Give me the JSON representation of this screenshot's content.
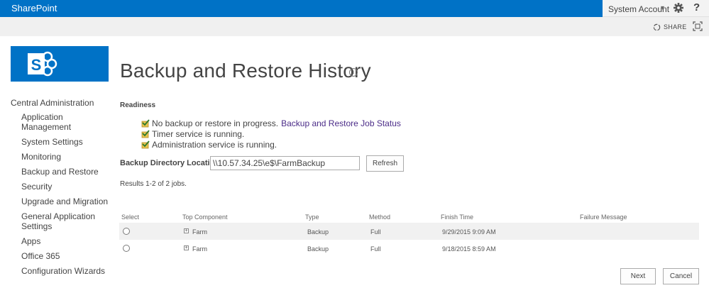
{
  "suitebar": {
    "brand": "SharePoint",
    "user_name": "System Account",
    "user_caret": "▾",
    "help_label": "?",
    "color": "#0072c6"
  },
  "ribbon": {
    "share_label": "SHARE"
  },
  "page": {
    "title": "Backup and Restore History",
    "info_glyph": "i"
  },
  "leftnav": {
    "root": "Central Administration",
    "items": [
      "Application Management",
      "System Settings",
      "Monitoring",
      "Backup and Restore",
      "Security",
      "Upgrade and Migration",
      "General Application Settings",
      "Apps",
      "Office 365",
      "Configuration Wizards"
    ]
  },
  "readiness": {
    "heading": "Readiness",
    "lines": [
      {
        "text": "No backup or restore in progress.",
        "link": "Backup and Restore Job Status"
      },
      {
        "text": "Timer service is running."
      },
      {
        "text": "Administration service is running."
      }
    ]
  },
  "backup_dir": {
    "label": "Backup Directory Location:",
    "value": "\\\\10.57.34.25\\e$\\FarmBackup",
    "refresh_label": "Refresh"
  },
  "results": {
    "summary": "Results 1-2 of 2 jobs."
  },
  "table": {
    "headers": [
      "Select",
      "Top Component",
      "Type",
      "Method",
      "Finish Time",
      "Failure Message"
    ],
    "rows": [
      {
        "component": "Farm",
        "type": "Backup",
        "method": "Full",
        "finish_time": "9/29/2015 9:09 AM",
        "failure": ""
      },
      {
        "component": "Farm",
        "type": "Backup",
        "method": "Full",
        "finish_time": "9/18/2015 8:59 AM",
        "failure": ""
      }
    ],
    "expand_glyph": "+"
  },
  "actions": {
    "next_label": "Next",
    "cancel_label": "Cancel"
  }
}
